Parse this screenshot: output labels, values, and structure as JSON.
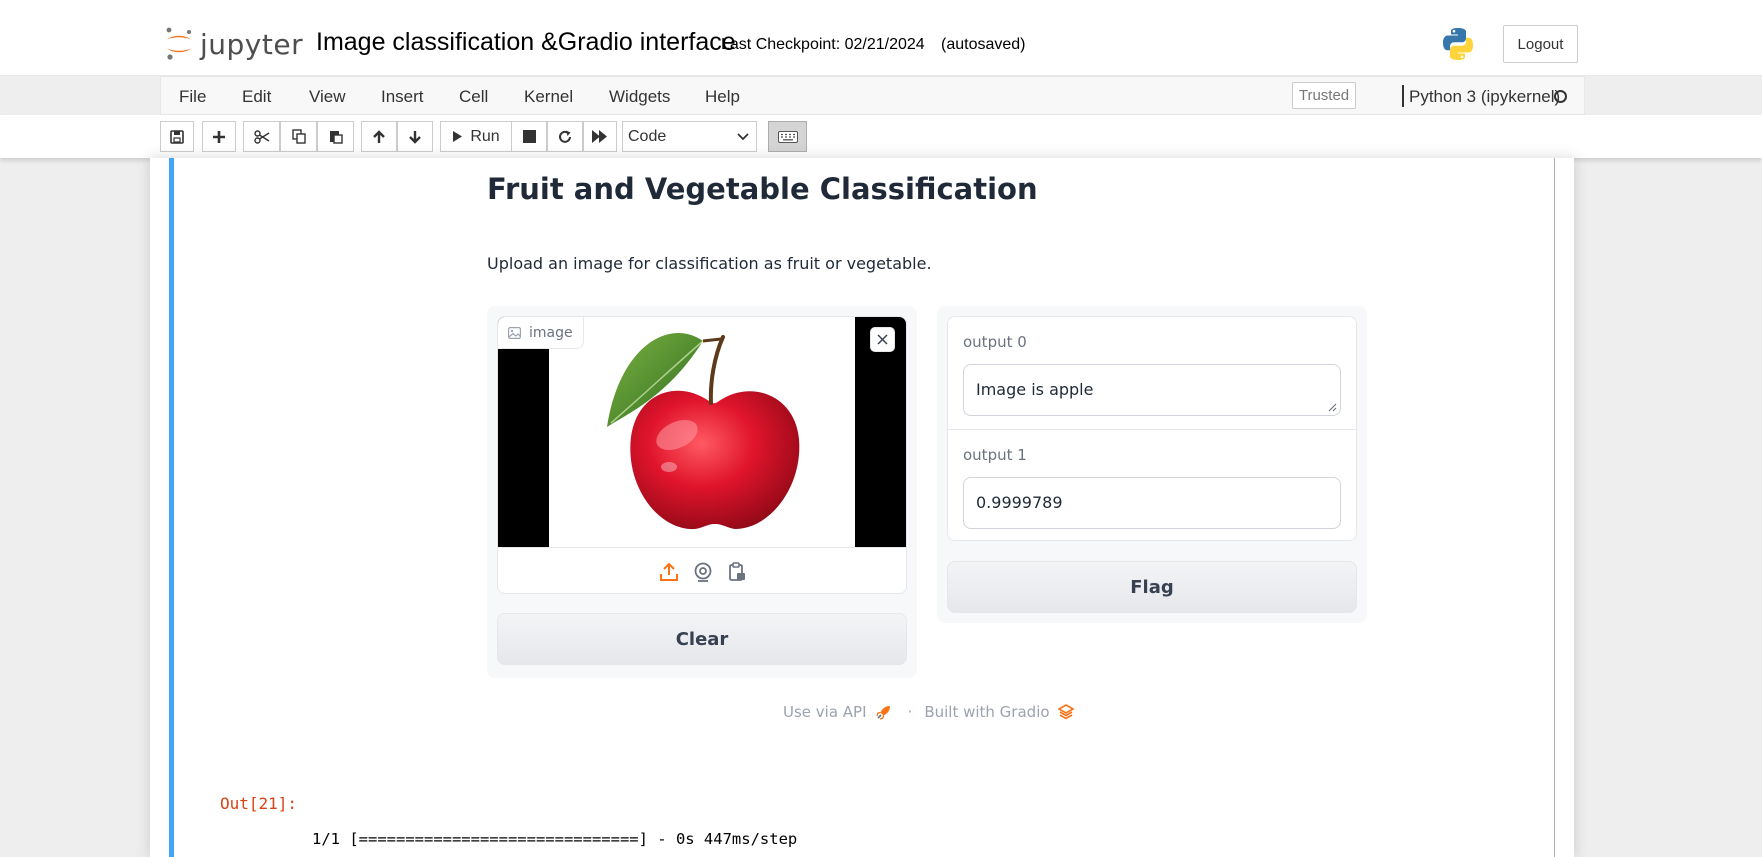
{
  "header": {
    "logo_text": "jupyter",
    "notebook_title": "Image classification &Gradio interface",
    "checkpoint_text": "Last Checkpoint: 02/21/2024",
    "autosave_status": "(autosaved)",
    "logout_label": "Logout"
  },
  "menubar": {
    "items": [
      "File",
      "Edit",
      "View",
      "Insert",
      "Cell",
      "Kernel",
      "Widgets",
      "Help"
    ],
    "trusted_label": "Trusted",
    "kernel_name": "Python 3 (ipykernel)"
  },
  "toolbar": {
    "buttons": [
      "save-icon",
      "plus-icon",
      "cut-icon",
      "copy-icon",
      "paste-icon",
      "arrow-up-icon",
      "arrow-down-icon",
      "run-icon",
      "stop-icon",
      "restart-icon",
      "fast-forward-icon"
    ],
    "run_label": "Run",
    "cell_type": "Code"
  },
  "gradio": {
    "title": "Fruit and Vegetable Classification",
    "description": "Upload an image for classification as fruit or vegetable.",
    "image_label": "image",
    "source_icons": [
      "upload-icon",
      "webcam-icon",
      "clipboard-icon"
    ],
    "clear_label": "Clear",
    "outputs": [
      {
        "label": "output 0",
        "value": "Image is apple"
      },
      {
        "label": "output 1",
        "value": "0.9999789"
      }
    ],
    "flag_label": "Flag",
    "footer": {
      "api_link": "Use via API",
      "separator": "·",
      "built_with": "Built with Gradio"
    }
  },
  "output": {
    "prompt": "Out[21]:",
    "stream": "1/1 [==============================] - 0s 447ms/step"
  },
  "colors": {
    "accent_orange": "#f97316",
    "cell_selected_blue": "#42a5f5",
    "out_prompt_red": "#d84315"
  }
}
